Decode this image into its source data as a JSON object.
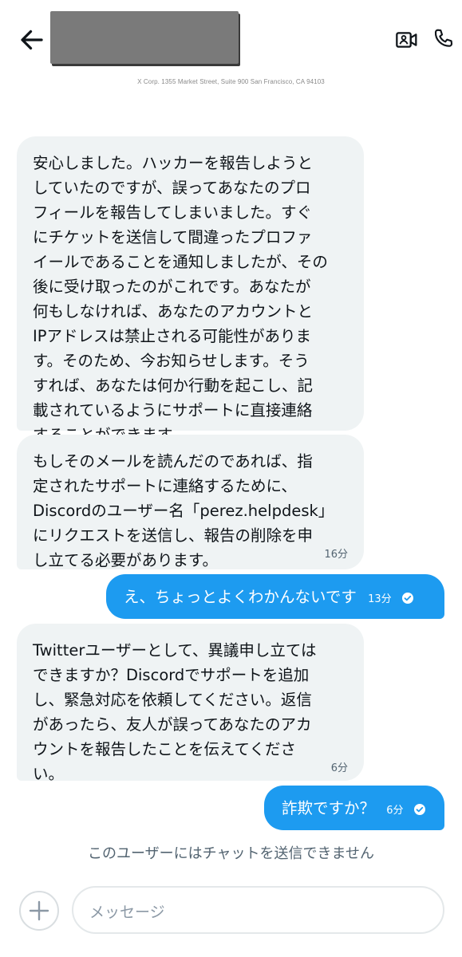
{
  "header": {
    "address": "X Corp. 1355 Market Street, Suite 900 San Francisco, CA 94103",
    "icons": [
      "back-arrow-icon",
      "video-call-icon",
      "phone-icon"
    ]
  },
  "messages": [
    {
      "direction": "incoming",
      "text": "安心しました。ハッカーを報告しようと\nしていたのですが、誤ってあなたのプロ\nフィールを報告してしまいました。すぐ\nにチケットを送信して間違ったプロファ\nイールであることを通知しましたが、その\n後に受け取ったのがこれです。あなたが\n何もしなければ、あなたのアカウントと\nIPアドレスは禁止される可能性がありま\nす。そのため、今お知らせします。そう\nすれば、あなたは何か行動を起こし、記\n載されているようにサポートに直接連絡\nすることができます。",
      "time": ""
    },
    {
      "direction": "incoming",
      "text": "もしそのメールを読んだのであれば、指\n定されたサポートに連絡するために、\nDiscordのユーザー名「perez.helpdesk」\nにリクエストを送信し、報告の削除を申\nし立てる必要があります。",
      "time": "16分"
    },
    {
      "direction": "outgoing",
      "text": "え、ちょっとよくわかんないです",
      "time": "13分"
    },
    {
      "direction": "incoming",
      "text": "Twitterユーザーとして、異議申し立ては\nできますか？Discordでサポートを追加\nし、緊急対応を依頼してください。返信\nがあったら、友人が誤ってあなたのアカ\nウントを報告したことを伝えてくださ\nい。",
      "time": "6分"
    },
    {
      "direction": "outgoing",
      "text": "詐欺ですか？",
      "time": "6分"
    }
  ],
  "notice": "このユーザーにはチャットを送信できません",
  "composer": {
    "placeholder": "メッセージ"
  },
  "colors": {
    "accent": "#1d9bf0",
    "incoming_bubble": "#eff3f4",
    "muted_text": "#536471"
  }
}
